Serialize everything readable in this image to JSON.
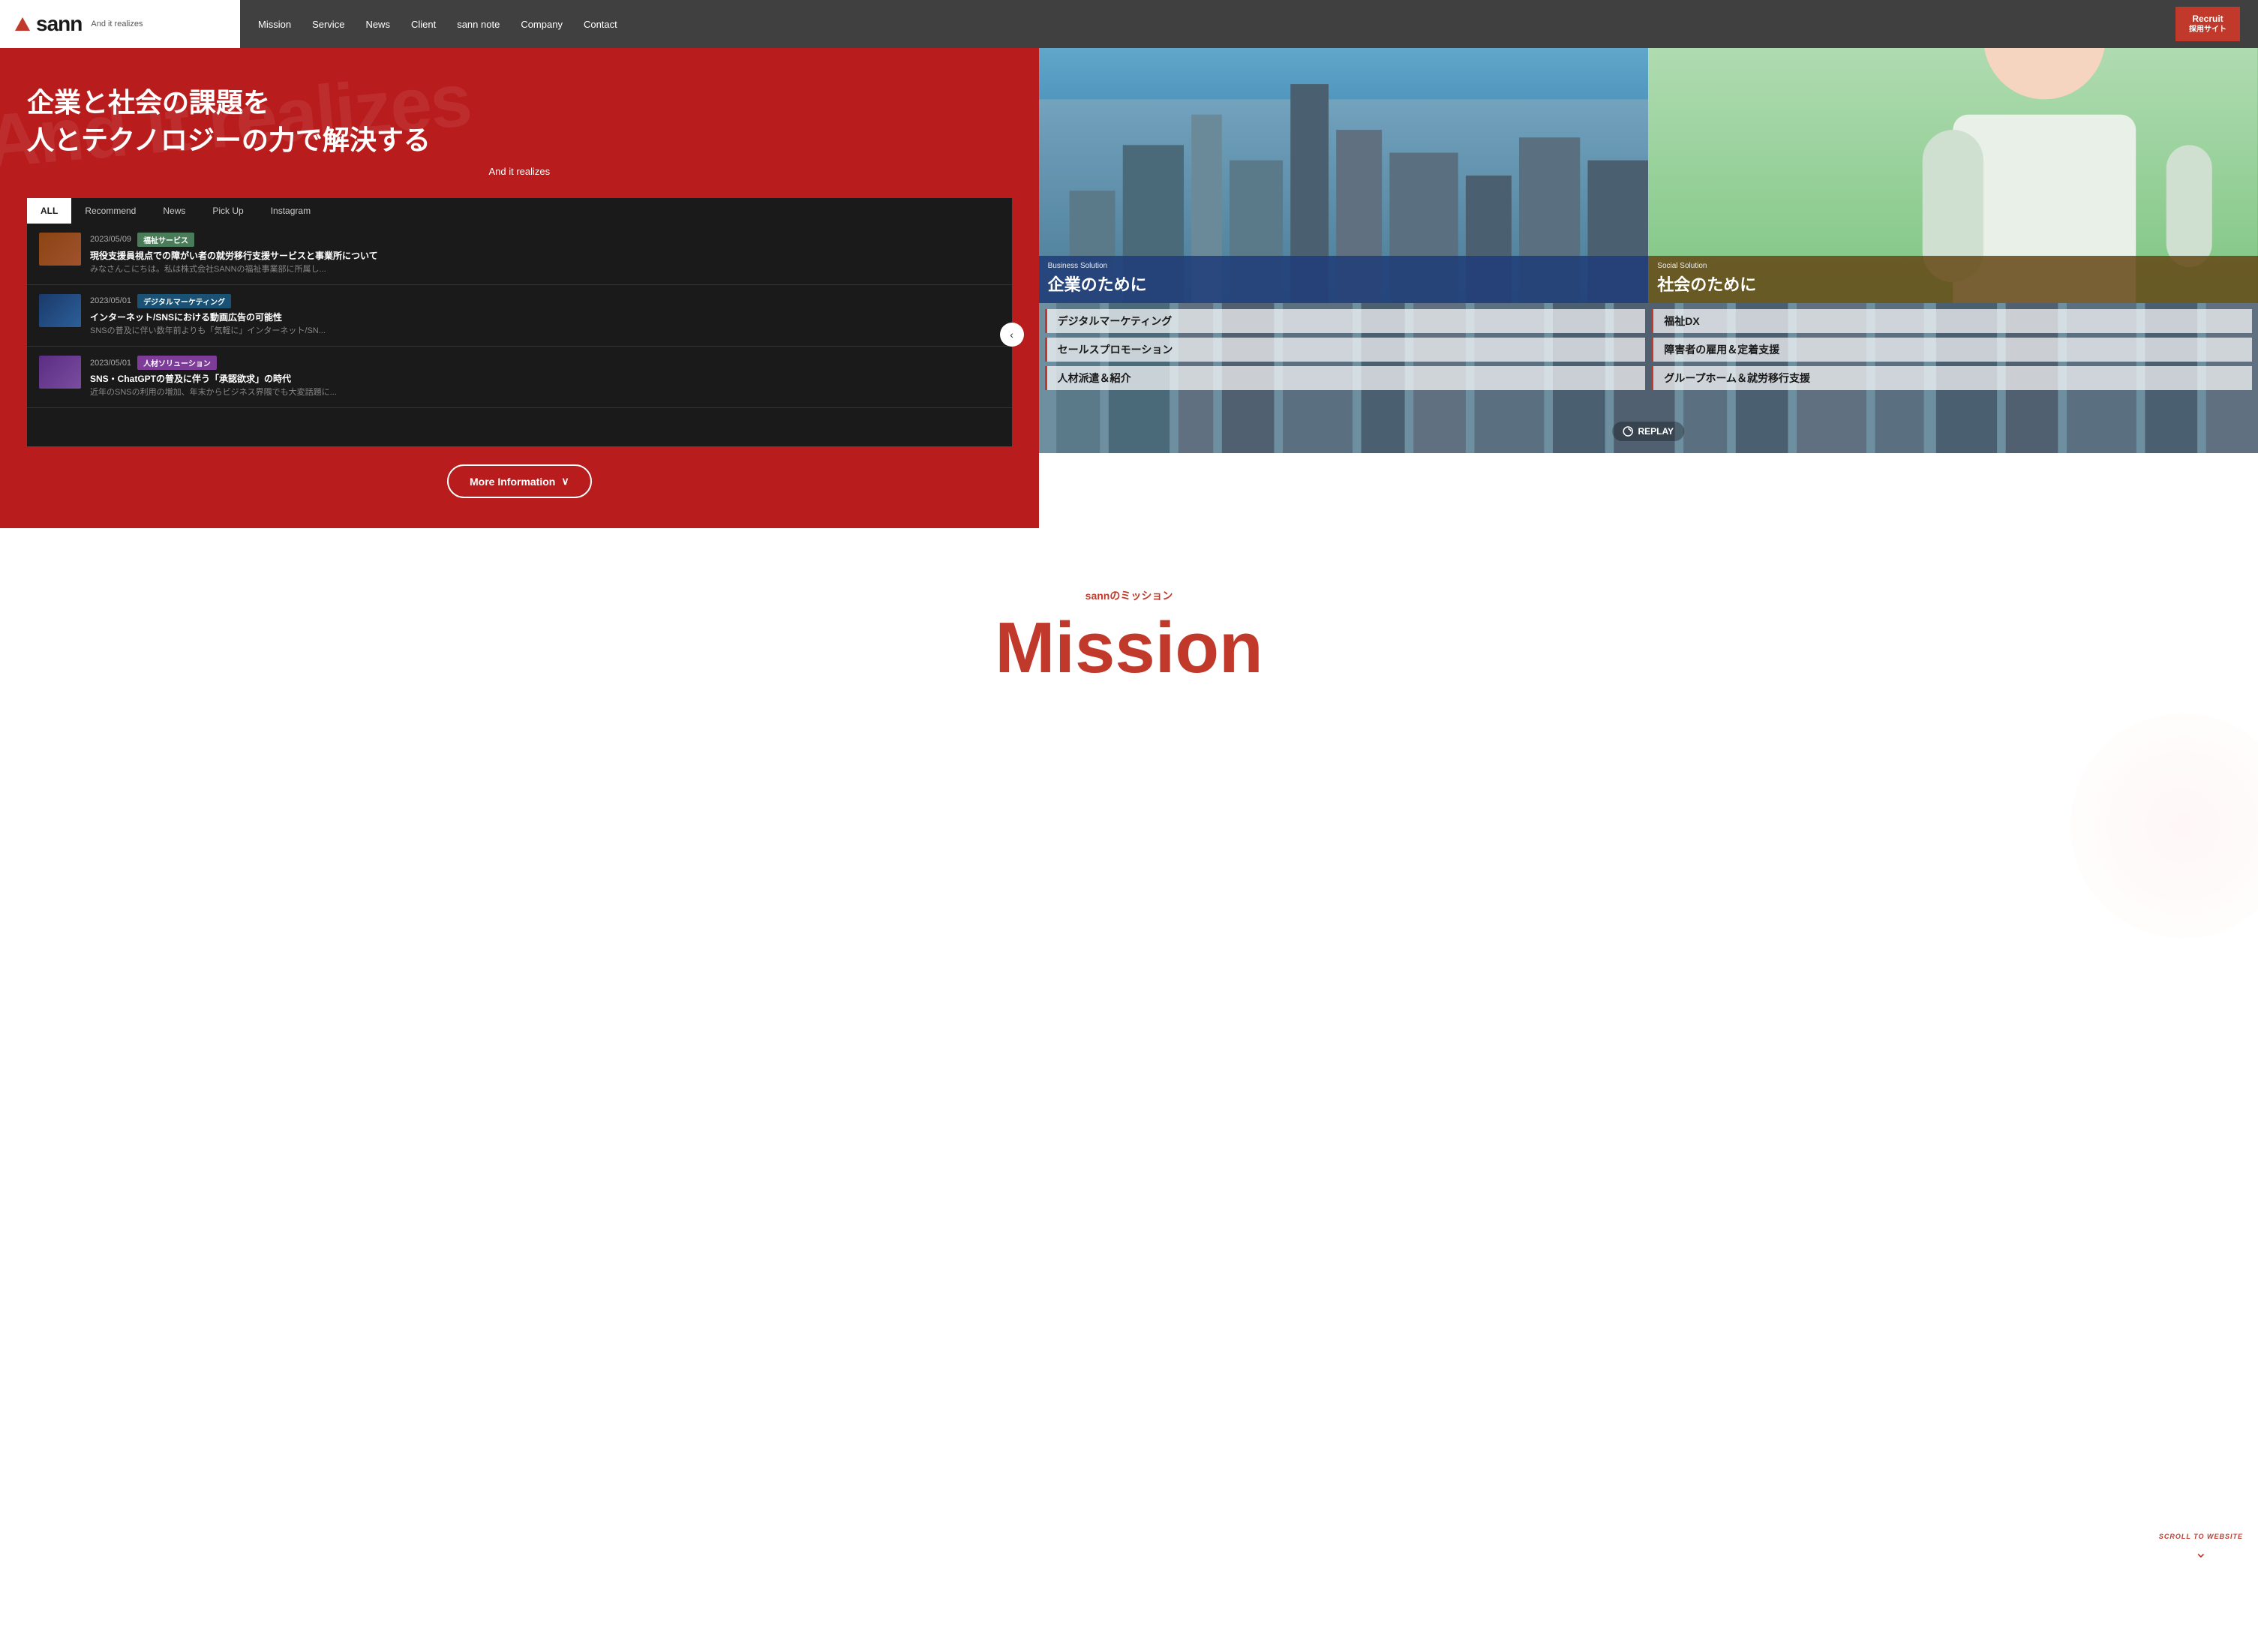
{
  "header": {
    "logo_triangle": "▲",
    "logo_text": "sann",
    "logo_tagline": "And it realizes",
    "nav_items": [
      {
        "label": "Mission",
        "id": "nav-mission"
      },
      {
        "label": "Service",
        "id": "nav-service"
      },
      {
        "label": "News",
        "id": "nav-news"
      },
      {
        "label": "Client",
        "id": "nav-client"
      },
      {
        "label": "sann note",
        "id": "nav-sann-note"
      },
      {
        "label": "Company",
        "id": "nav-company"
      },
      {
        "label": "Contact",
        "id": "nav-contact"
      }
    ],
    "recruit_label": "Recruit",
    "recruit_sub": "採用サイト"
  },
  "hero": {
    "headline_line1": "企業と社会の課題を",
    "headline_line2": "人とテクノロジーの力で解決する",
    "subheadline": "And it realizes",
    "watermark": "And it realizes"
  },
  "news_tabs": [
    {
      "label": "ALL",
      "active": true
    },
    {
      "label": "Recommend",
      "active": false
    },
    {
      "label": "News",
      "active": false
    },
    {
      "label": "Pick Up",
      "active": false
    },
    {
      "label": "Instagram",
      "active": false
    }
  ],
  "news_items": [
    {
      "date": "2023/05/09",
      "tag_label": "福祉サービス",
      "tag_class": "tag-fukushi",
      "title": "現役支援員視点での障がい者の就労移行支援サービスと事業所について",
      "excerpt": "みなさんこにちは。私は株式会社SANNの福祉事業部に所属し..."
    },
    {
      "date": "2023/05/01",
      "tag_label": "デジタルマーケティング",
      "tag_class": "tag-digital",
      "title": "インターネット/SNSにおける動画広告の可能性",
      "excerpt": "SNSの普及に伴い数年前よりも「気軽に」インターネット/SN..."
    },
    {
      "date": "2023/05/01",
      "tag_label": "人材ソリューション",
      "tag_class": "tag-jinzai",
      "title": "SNS・ChatGPTの普及に伴う「承認欲求」の時代",
      "excerpt": "近年のSNSの利用の増加、年末からビジネス界隈でも大変話題に..."
    }
  ],
  "more_info_btn": "More Information",
  "more_info_arrow": "∨",
  "solutions": {
    "business_label": "Business Solution",
    "business_title": "企業のために",
    "social_label": "Social Solution",
    "social_title": "社会のために"
  },
  "services_left": [
    "デジタルマーケティング",
    "セールスプロモーション",
    "人材派遣＆紹介"
  ],
  "services_right": [
    "福祉DX",
    "障害者の雇用＆定着支援",
    "グループホーム＆就労移行支援"
  ],
  "replay_label": "REPLAY",
  "scroll_label": "SCROLL TO WEBSITE",
  "mission_section": {
    "sub_label": "sannのミッション",
    "title": "Mission"
  }
}
